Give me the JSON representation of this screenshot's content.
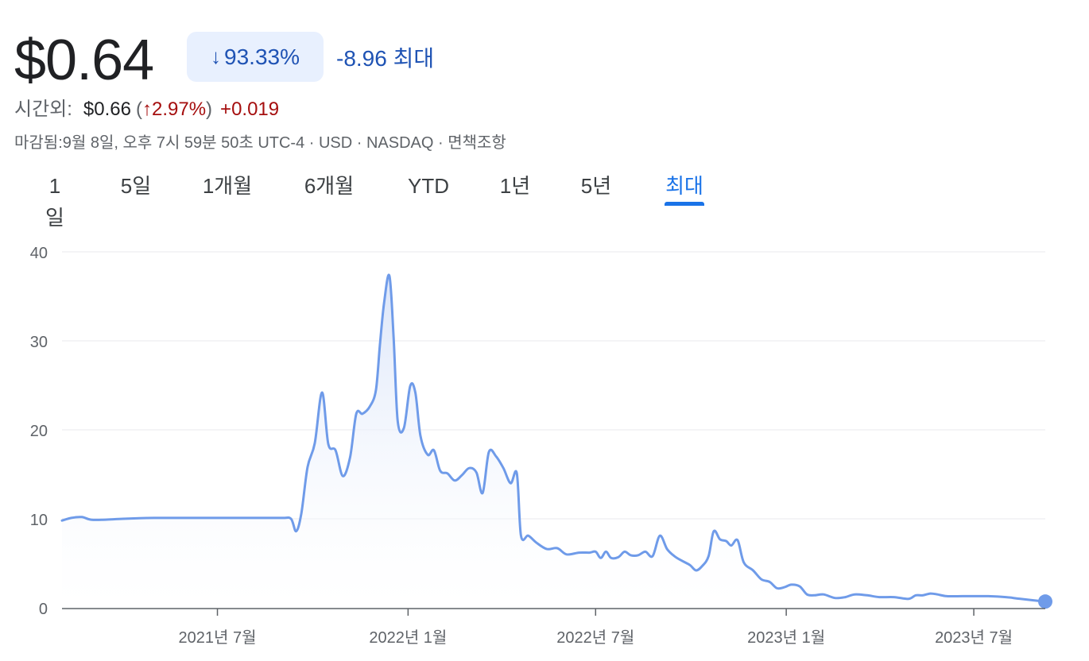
{
  "quote": {
    "price": "$0.64",
    "change_arrow": "↓",
    "change_pct": "93.33%",
    "change_abs": "-8.96 최대"
  },
  "after_hours": {
    "label": "시간외:",
    "price": "$0.66",
    "open_paren": "(",
    "arrow": "↑",
    "pct": "2.97%",
    "close_paren": ")",
    "abs": "+0.019"
  },
  "meta_line": "마감됨:9월 8일, 오후 7시 59분 50초 UTC-4 · USD · NASDAQ · 면책조항",
  "tabs": {
    "items": [
      "1일",
      "5일",
      "1개월",
      "6개월",
      "YTD",
      "1년",
      "5년",
      "최대"
    ],
    "active": "최대"
  },
  "colors": {
    "line": "#6f9be9",
    "fill_top": "#dbe5f9",
    "accent": "#1a73e8",
    "down": "#1f53b4",
    "up": "#a50e0e"
  },
  "chart_data": {
    "type": "area",
    "y_ticks": [
      0,
      10,
      20,
      30,
      40
    ],
    "ylim": [
      0,
      40
    ],
    "x_tick_labels": [
      "2021년 7월",
      "2022년 1월",
      "2022년 7월",
      "2023년 1월",
      "2023년 7월"
    ],
    "x_ticks": [
      "2021-07-01",
      "2022-01-01",
      "2022-07-01",
      "2023-01-01",
      "2023-07-01"
    ],
    "x_range": [
      "2021-02-01",
      "2023-09-08"
    ],
    "grid": true,
    "series": [
      {
        "points": [
          [
            "2021-02-01",
            9.8
          ],
          [
            "2021-02-10",
            10.1
          ],
          [
            "2021-02-20",
            10.2
          ],
          [
            "2021-03-01",
            9.9
          ],
          [
            "2021-03-15",
            9.9
          ],
          [
            "2021-04-01",
            10.0
          ],
          [
            "2021-05-01",
            10.1
          ],
          [
            "2021-06-01",
            10.1
          ],
          [
            "2021-07-01",
            10.1
          ],
          [
            "2021-08-01",
            10.1
          ],
          [
            "2021-09-01",
            10.1
          ],
          [
            "2021-09-10",
            10.0
          ],
          [
            "2021-09-15",
            8.6
          ],
          [
            "2021-09-20",
            10.6
          ],
          [
            "2021-09-26",
            15.8
          ],
          [
            "2021-10-03",
            18.5
          ],
          [
            "2021-10-10",
            24.2
          ],
          [
            "2021-10-16",
            18.4
          ],
          [
            "2021-10-23",
            17.7
          ],
          [
            "2021-10-30",
            14.8
          ],
          [
            "2021-11-06",
            16.9
          ],
          [
            "2021-11-12",
            21.8
          ],
          [
            "2021-11-18",
            21.8
          ],
          [
            "2021-11-25",
            22.6
          ],
          [
            "2021-12-01",
            24.5
          ],
          [
            "2021-12-05",
            29.8
          ],
          [
            "2021-12-09",
            34.4
          ],
          [
            "2021-12-14",
            37.3
          ],
          [
            "2021-12-18",
            30.5
          ],
          [
            "2021-12-22",
            21.0
          ],
          [
            "2021-12-28",
            20.2
          ],
          [
            "2022-01-03",
            24.9
          ],
          [
            "2022-01-08",
            24.2
          ],
          [
            "2022-01-13",
            19.3
          ],
          [
            "2022-01-20",
            17.2
          ],
          [
            "2022-01-26",
            17.7
          ],
          [
            "2022-02-01",
            15.4
          ],
          [
            "2022-02-08",
            15.1
          ],
          [
            "2022-02-15",
            14.3
          ],
          [
            "2022-02-22",
            14.9
          ],
          [
            "2022-03-01",
            15.7
          ],
          [
            "2022-03-08",
            15.2
          ],
          [
            "2022-03-14",
            12.9
          ],
          [
            "2022-03-20",
            17.5
          ],
          [
            "2022-03-27",
            17.0
          ],
          [
            "2022-04-03",
            15.7
          ],
          [
            "2022-04-10",
            14.0
          ],
          [
            "2022-04-16",
            15.1
          ],
          [
            "2022-04-20",
            8.1
          ],
          [
            "2022-04-27",
            8.1
          ],
          [
            "2022-05-05",
            7.3
          ],
          [
            "2022-05-15",
            6.6
          ],
          [
            "2022-05-25",
            6.7
          ],
          [
            "2022-06-03",
            6.0
          ],
          [
            "2022-06-15",
            6.2
          ],
          [
            "2022-06-25",
            6.2
          ],
          [
            "2022-07-01",
            6.3
          ],
          [
            "2022-07-06",
            5.6
          ],
          [
            "2022-07-11",
            6.3
          ],
          [
            "2022-07-16",
            5.6
          ],
          [
            "2022-07-23",
            5.7
          ],
          [
            "2022-07-29",
            6.3
          ],
          [
            "2022-08-04",
            5.9
          ],
          [
            "2022-08-11",
            5.9
          ],
          [
            "2022-08-18",
            6.3
          ],
          [
            "2022-08-25",
            5.8
          ],
          [
            "2022-09-01",
            8.1
          ],
          [
            "2022-09-08",
            6.6
          ],
          [
            "2022-09-15",
            5.8
          ],
          [
            "2022-09-22",
            5.3
          ],
          [
            "2022-09-30",
            4.8
          ],
          [
            "2022-10-06",
            4.2
          ],
          [
            "2022-10-12",
            4.7
          ],
          [
            "2022-10-18",
            5.8
          ],
          [
            "2022-10-23",
            8.6
          ],
          [
            "2022-10-29",
            7.7
          ],
          [
            "2022-11-04",
            7.5
          ],
          [
            "2022-11-09",
            7.0
          ],
          [
            "2022-11-15",
            7.6
          ],
          [
            "2022-11-21",
            5.1
          ],
          [
            "2022-11-30",
            4.2
          ],
          [
            "2022-12-08",
            3.2
          ],
          [
            "2022-12-16",
            2.9
          ],
          [
            "2022-12-23",
            2.2
          ],
          [
            "2022-12-30",
            2.3
          ],
          [
            "2023-01-06",
            2.6
          ],
          [
            "2023-01-14",
            2.4
          ],
          [
            "2023-01-21",
            1.5
          ],
          [
            "2023-01-28",
            1.4
          ],
          [
            "2023-02-06",
            1.5
          ],
          [
            "2023-02-17",
            1.1
          ],
          [
            "2023-02-27",
            1.2
          ],
          [
            "2023-03-08",
            1.5
          ],
          [
            "2023-03-20",
            1.4
          ],
          [
            "2023-04-01",
            1.2
          ],
          [
            "2023-04-15",
            1.2
          ],
          [
            "2023-04-29",
            1.0
          ],
          [
            "2023-05-06",
            1.4
          ],
          [
            "2023-05-13",
            1.4
          ],
          [
            "2023-05-20",
            1.6
          ],
          [
            "2023-05-27",
            1.5
          ],
          [
            "2023-06-05",
            1.3
          ],
          [
            "2023-06-20",
            1.3
          ],
          [
            "2023-07-01",
            1.3
          ],
          [
            "2023-07-15",
            1.3
          ],
          [
            "2023-08-01",
            1.2
          ],
          [
            "2023-08-15",
            1.0
          ],
          [
            "2023-09-08",
            0.7
          ]
        ]
      }
    ]
  }
}
